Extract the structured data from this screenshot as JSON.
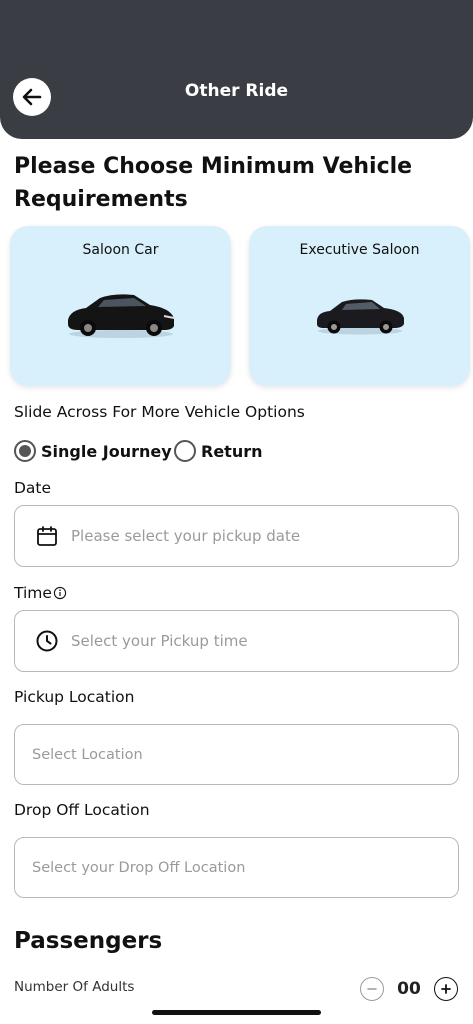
{
  "header": {
    "title": "Other Ride",
    "background": "#3a3e44"
  },
  "main": {
    "heading": "Please Choose Minimum Vehicle Requirements",
    "vehicles": [
      {
        "name": "Saloon Car",
        "icon": "car-icon"
      },
      {
        "name": "Executive Saloon",
        "icon": "car-icon"
      }
    ],
    "slide_hint": "Slide Across For More Vehicle Options",
    "journey_options": [
      {
        "label": "Single Journey",
        "selected": true
      },
      {
        "label": "Return",
        "selected": false
      }
    ],
    "date": {
      "label": "Date",
      "placeholder": "Please select your pickup date",
      "icon": "calendar-icon"
    },
    "time": {
      "label": "Time",
      "placeholder": "Select your Pickup time",
      "icon": "clock-icon",
      "info_icon": "info-icon"
    },
    "pickup": {
      "label": "Pickup Location",
      "placeholder": "Select Location"
    },
    "dropoff": {
      "label": "Drop Off Location",
      "placeholder": "Select your Drop Off Location"
    },
    "passengers": {
      "title": "Passengers",
      "adults_label": "Number Of Adults",
      "adults_value": "00"
    }
  },
  "colors": {
    "card_bg": "#d8effc",
    "header_bg": "#3a3e44"
  }
}
